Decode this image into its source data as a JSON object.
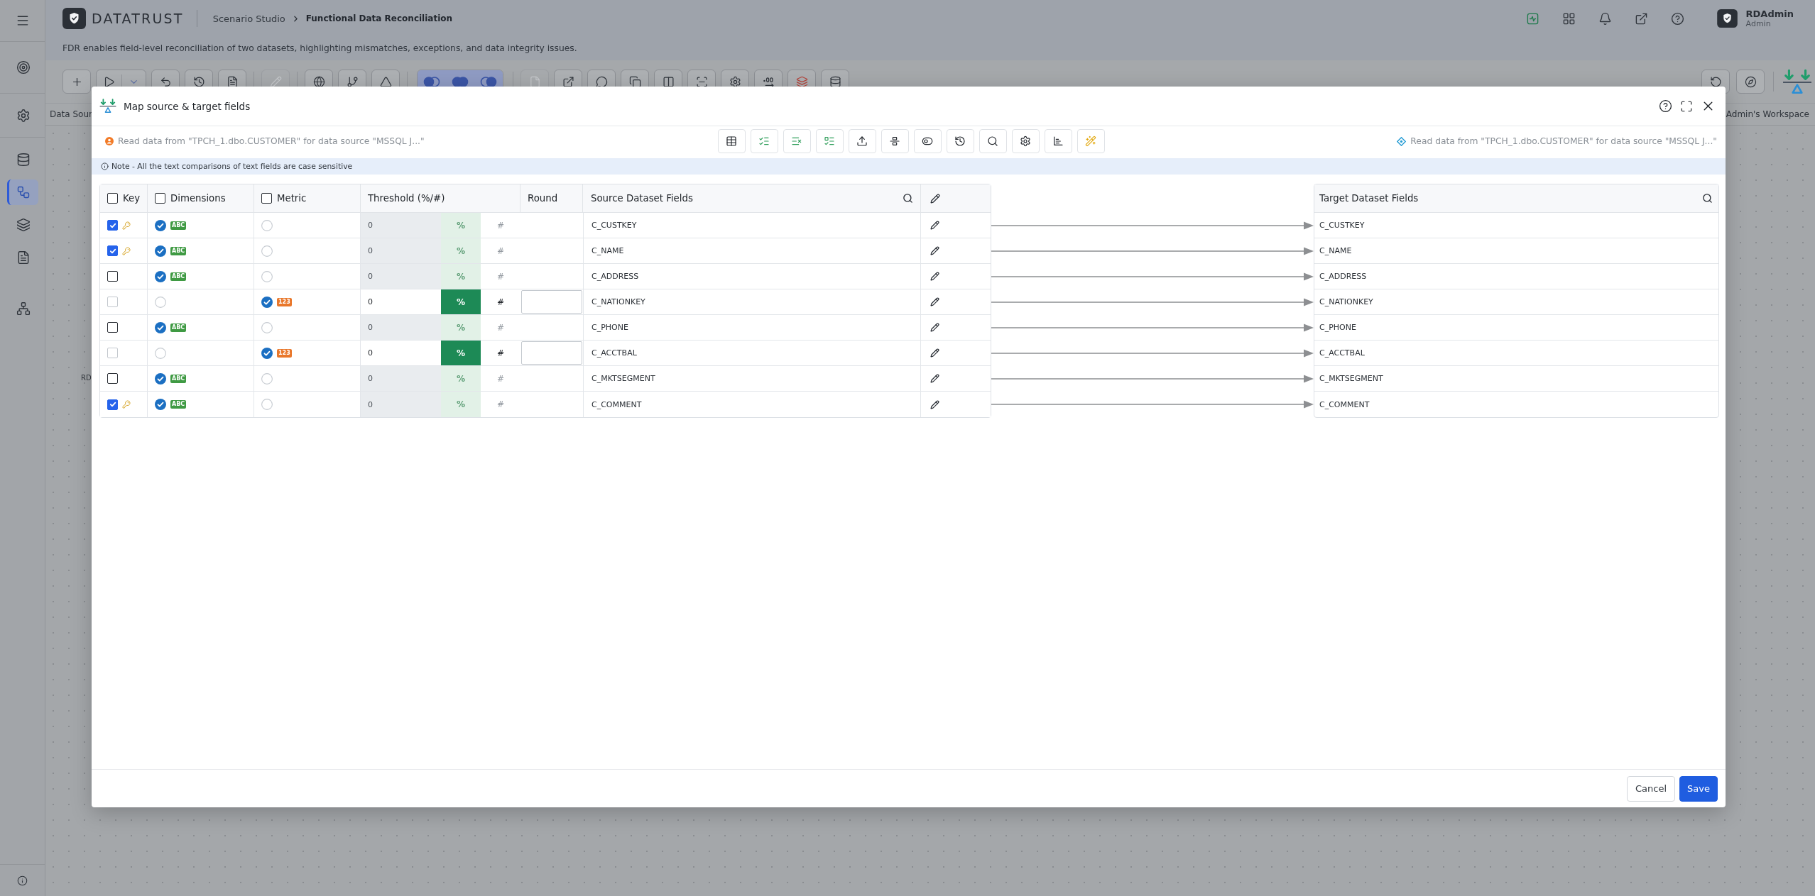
{
  "app": {
    "sidebar": {
      "items": [
        {
          "kind": "target",
          "selected": false
        },
        {
          "kind": "settings",
          "selected": false
        },
        {
          "kind": "database",
          "selected": false
        },
        {
          "kind": "flow",
          "selected": true
        },
        {
          "kind": "layers",
          "selected": false
        },
        {
          "kind": "document",
          "selected": false
        },
        {
          "kind": "integration",
          "selected": false
        }
      ]
    },
    "brand": "DATATRUST",
    "breadcrumb": [
      {
        "label": "Scenario Studio",
        "current": false
      },
      {
        "label": "Functional Data Reconciliation",
        "current": true
      }
    ],
    "description": "FDR enables field-level reconciliation of two datasets, highlighting mismatches, exceptions, and data integrity issues.",
    "header_actions": [
      {
        "kind": "activity"
      },
      {
        "kind": "apps"
      },
      {
        "kind": "notifications"
      },
      {
        "kind": "open-external"
      },
      {
        "kind": "help"
      }
    ],
    "user": {
      "name": "RDAdmin",
      "role": "Admin"
    },
    "toolbar": {
      "groups": [
        {
          "kind": "buttons",
          "items": [
            {
              "kind": "add",
              "disabled": false
            },
            {
              "kind": "run",
              "disabled": false
            },
            {
              "kind": "undo",
              "disabled": false
            },
            {
              "kind": "history",
              "disabled": false
            },
            {
              "kind": "report",
              "disabled": false
            }
          ]
        },
        {
          "kind": "buttons",
          "items": [
            {
              "kind": "edit",
              "disabled": true
            }
          ]
        },
        {
          "kind": "buttons",
          "items": [
            {
              "kind": "globe",
              "disabled": false
            },
            {
              "kind": "branch",
              "disabled": false
            },
            {
              "kind": "measure",
              "disabled": false
            }
          ]
        },
        {
          "kind": "segmented",
          "items": [
            {
              "kind": "venn-left",
              "selected": true
            },
            {
              "kind": "venn-both",
              "selected": true
            },
            {
              "kind": "venn-right",
              "selected": true
            }
          ]
        },
        {
          "kind": "buttons",
          "items": [
            {
              "kind": "file",
              "disabled": true
            },
            {
              "kind": "export",
              "disabled": false
            },
            {
              "kind": "comment",
              "disabled": false
            },
            {
              "kind": "copy",
              "disabled": false
            },
            {
              "kind": "compare",
              "disabled": false
            },
            {
              "kind": "scan",
              "disabled": false
            },
            {
              "kind": "settings",
              "disabled": false
            },
            {
              "kind": "decimal",
              "disabled": false
            },
            {
              "kind": "stack",
              "disabled": false
            },
            {
              "kind": "database",
              "disabled": false
            }
          ]
        }
      ],
      "right": [
        {
          "kind": "version",
          "disabled": false
        },
        {
          "kind": "compass",
          "disabled": false
        }
      ]
    },
    "panel_title": "Data Sour",
    "workspace_label": "Admin's Workspace",
    "canvas_labels": [
      "RD"
    ]
  },
  "dialog": {
    "title": "Map source & target fields",
    "header_actions": [
      {
        "kind": "help"
      },
      {
        "kind": "expand"
      },
      {
        "kind": "close"
      }
    ],
    "source_info": "Read data from \"TPCH_1.dbo.CUSTOMER\" for data source \"MSSQL J...\"",
    "tools": [
      {
        "kind": "table"
      },
      {
        "kind": "list-checked"
      },
      {
        "kind": "list-unchecked"
      },
      {
        "kind": "list-pending"
      },
      {
        "kind": "upload"
      },
      {
        "kind": "align"
      },
      {
        "kind": "toggle"
      },
      {
        "kind": "history"
      },
      {
        "kind": "search"
      },
      {
        "kind": "settings"
      },
      {
        "kind": "chart"
      },
      {
        "kind": "magic"
      }
    ],
    "target_info": "Read data from \"TPCH_1.dbo.CUSTOMER\" for data source \"MSSQL J...\"",
    "note": "Note - All the text comparisons of text fields are case sensitive",
    "columns": {
      "key": {
        "label": "Key",
        "checked": false
      },
      "dimensions": {
        "label": "Dimensions",
        "checked": false
      },
      "metric": {
        "label": "Metric",
        "checked": false
      },
      "threshold": "Threshold (%/#)",
      "round": "Round",
      "source": "Source Dataset Fields",
      "target": "Target Dataset Fields"
    },
    "rows": [
      {
        "key": {
          "checked": true,
          "disabled": false
        },
        "dimension": {
          "checked": true
        },
        "metric": {
          "checked": false
        },
        "type_tag": {
          "label": "ABC",
          "kind": "text"
        },
        "threshold": {
          "value": "0",
          "disabled": true,
          "units": [
            {
              "label": "%",
              "selected": true
            },
            {
              "label": "#",
              "selected": false
            }
          ]
        },
        "source": "C_CUSTKEY",
        "target": "C_CUSTKEY"
      },
      {
        "key": {
          "checked": true,
          "disabled": false
        },
        "dimension": {
          "checked": true
        },
        "metric": {
          "checked": false
        },
        "type_tag": {
          "label": "ABC",
          "kind": "text"
        },
        "threshold": {
          "value": "0",
          "disabled": true,
          "units": [
            {
              "label": "%",
              "selected": true
            },
            {
              "label": "#",
              "selected": false
            }
          ]
        },
        "source": "C_NAME",
        "target": "C_NAME"
      },
      {
        "key": {
          "checked": false,
          "disabled": false
        },
        "dimension": {
          "checked": true
        },
        "metric": {
          "checked": false
        },
        "type_tag": {
          "label": "ABC",
          "kind": "text"
        },
        "threshold": {
          "value": "0",
          "disabled": true,
          "units": [
            {
              "label": "%",
              "selected": true
            },
            {
              "label": "#",
              "selected": false
            }
          ]
        },
        "source": "C_ADDRESS",
        "target": "C_ADDRESS"
      },
      {
        "key": {
          "checked": false,
          "disabled": true
        },
        "dimension": {
          "checked": false
        },
        "metric": {
          "checked": true
        },
        "type_tag": {
          "label": "123",
          "kind": "number"
        },
        "threshold": {
          "value": "0",
          "disabled": false,
          "units": [
            {
              "label": "%",
              "selected": true
            },
            {
              "label": "#",
              "selected": false
            }
          ]
        },
        "source": "C_NATIONKEY",
        "target": "C_NATIONKEY"
      },
      {
        "key": {
          "checked": false,
          "disabled": false
        },
        "dimension": {
          "checked": true
        },
        "metric": {
          "checked": false
        },
        "type_tag": {
          "label": "ABC",
          "kind": "text"
        },
        "threshold": {
          "value": "0",
          "disabled": true,
          "units": [
            {
              "label": "%",
              "selected": true
            },
            {
              "label": "#",
              "selected": false
            }
          ]
        },
        "source": "C_PHONE",
        "target": "C_PHONE"
      },
      {
        "key": {
          "checked": false,
          "disabled": true
        },
        "dimension": {
          "checked": false
        },
        "metric": {
          "checked": true
        },
        "type_tag": {
          "label": "123",
          "kind": "number"
        },
        "threshold": {
          "value": "0",
          "disabled": false,
          "units": [
            {
              "label": "%",
              "selected": true
            },
            {
              "label": "#",
              "selected": false
            }
          ]
        },
        "source": "C_ACCTBAL",
        "target": "C_ACCTBAL"
      },
      {
        "key": {
          "checked": false,
          "disabled": false
        },
        "dimension": {
          "checked": true
        },
        "metric": {
          "checked": false
        },
        "type_tag": {
          "label": "ABC",
          "kind": "text"
        },
        "threshold": {
          "value": "0",
          "disabled": true,
          "units": [
            {
              "label": "%",
              "selected": true
            },
            {
              "label": "#",
              "selected": false
            }
          ]
        },
        "source": "C_MKTSEGMENT",
        "target": "C_MKTSEGMENT"
      },
      {
        "key": {
          "checked": true,
          "disabled": false
        },
        "dimension": {
          "checked": true
        },
        "metric": {
          "checked": false
        },
        "type_tag": {
          "label": "ABC",
          "kind": "text"
        },
        "threshold": {
          "value": "0",
          "disabled": true,
          "units": [
            {
              "label": "%",
              "selected": true
            },
            {
              "label": "#",
              "selected": false
            }
          ]
        },
        "source": "C_COMMENT",
        "target": "C_COMMENT"
      }
    ],
    "buttons": [
      {
        "label": "Cancel",
        "kind": "secondary"
      },
      {
        "label": "Save",
        "kind": "primary"
      }
    ]
  }
}
